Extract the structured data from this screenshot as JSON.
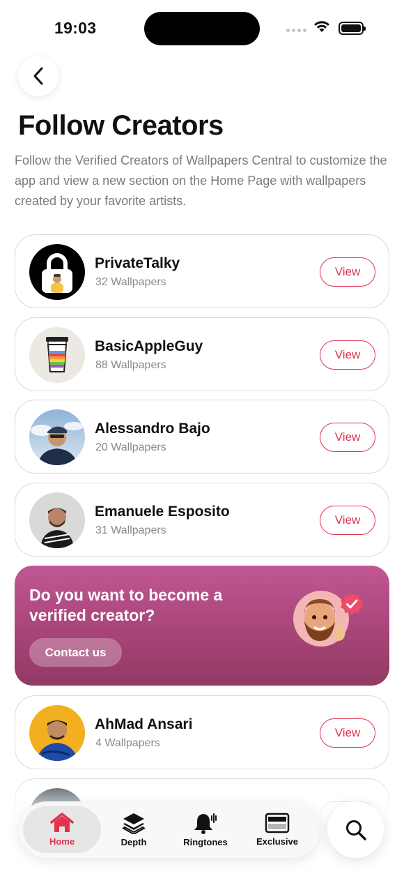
{
  "status_bar": {
    "time": "19:03"
  },
  "header": {
    "title": "Follow Creators",
    "description": "Follow the Verified Creators of Wallpapers Central to customize the app and view a new section on the Home Page with wallpapers created by your favorite artists."
  },
  "creators": [
    {
      "name": "PrivateTalky",
      "count": "32 Wallpapers",
      "button": "View"
    },
    {
      "name": "BasicAppleGuy",
      "count": "88 Wallpapers",
      "button": "View"
    },
    {
      "name": "Alessandro Bajo",
      "count": "20 Wallpapers",
      "button": "View"
    },
    {
      "name": "Emanuele Esposito",
      "count": "31 Wallpapers",
      "button": "View"
    },
    {
      "name": "AhMad Ansari",
      "count": "4 Wallpapers",
      "button": "View"
    }
  ],
  "promo": {
    "title": "Do you want to become a verified creator?",
    "button": "Contact us"
  },
  "tabbar": {
    "tabs": [
      {
        "label": "Home",
        "icon": "house-icon",
        "active": true
      },
      {
        "label": "Depth",
        "icon": "layers-icon",
        "active": false
      },
      {
        "label": "Ringtones",
        "icon": "bell-waves-icon",
        "active": false
      },
      {
        "label": "Exclusive",
        "icon": "display-icon",
        "active": false
      }
    ],
    "search_icon": "magnifier-icon"
  },
  "colors": {
    "accent": "#e0334e",
    "promo_top": "#c15695",
    "promo_bottom": "#933964"
  }
}
